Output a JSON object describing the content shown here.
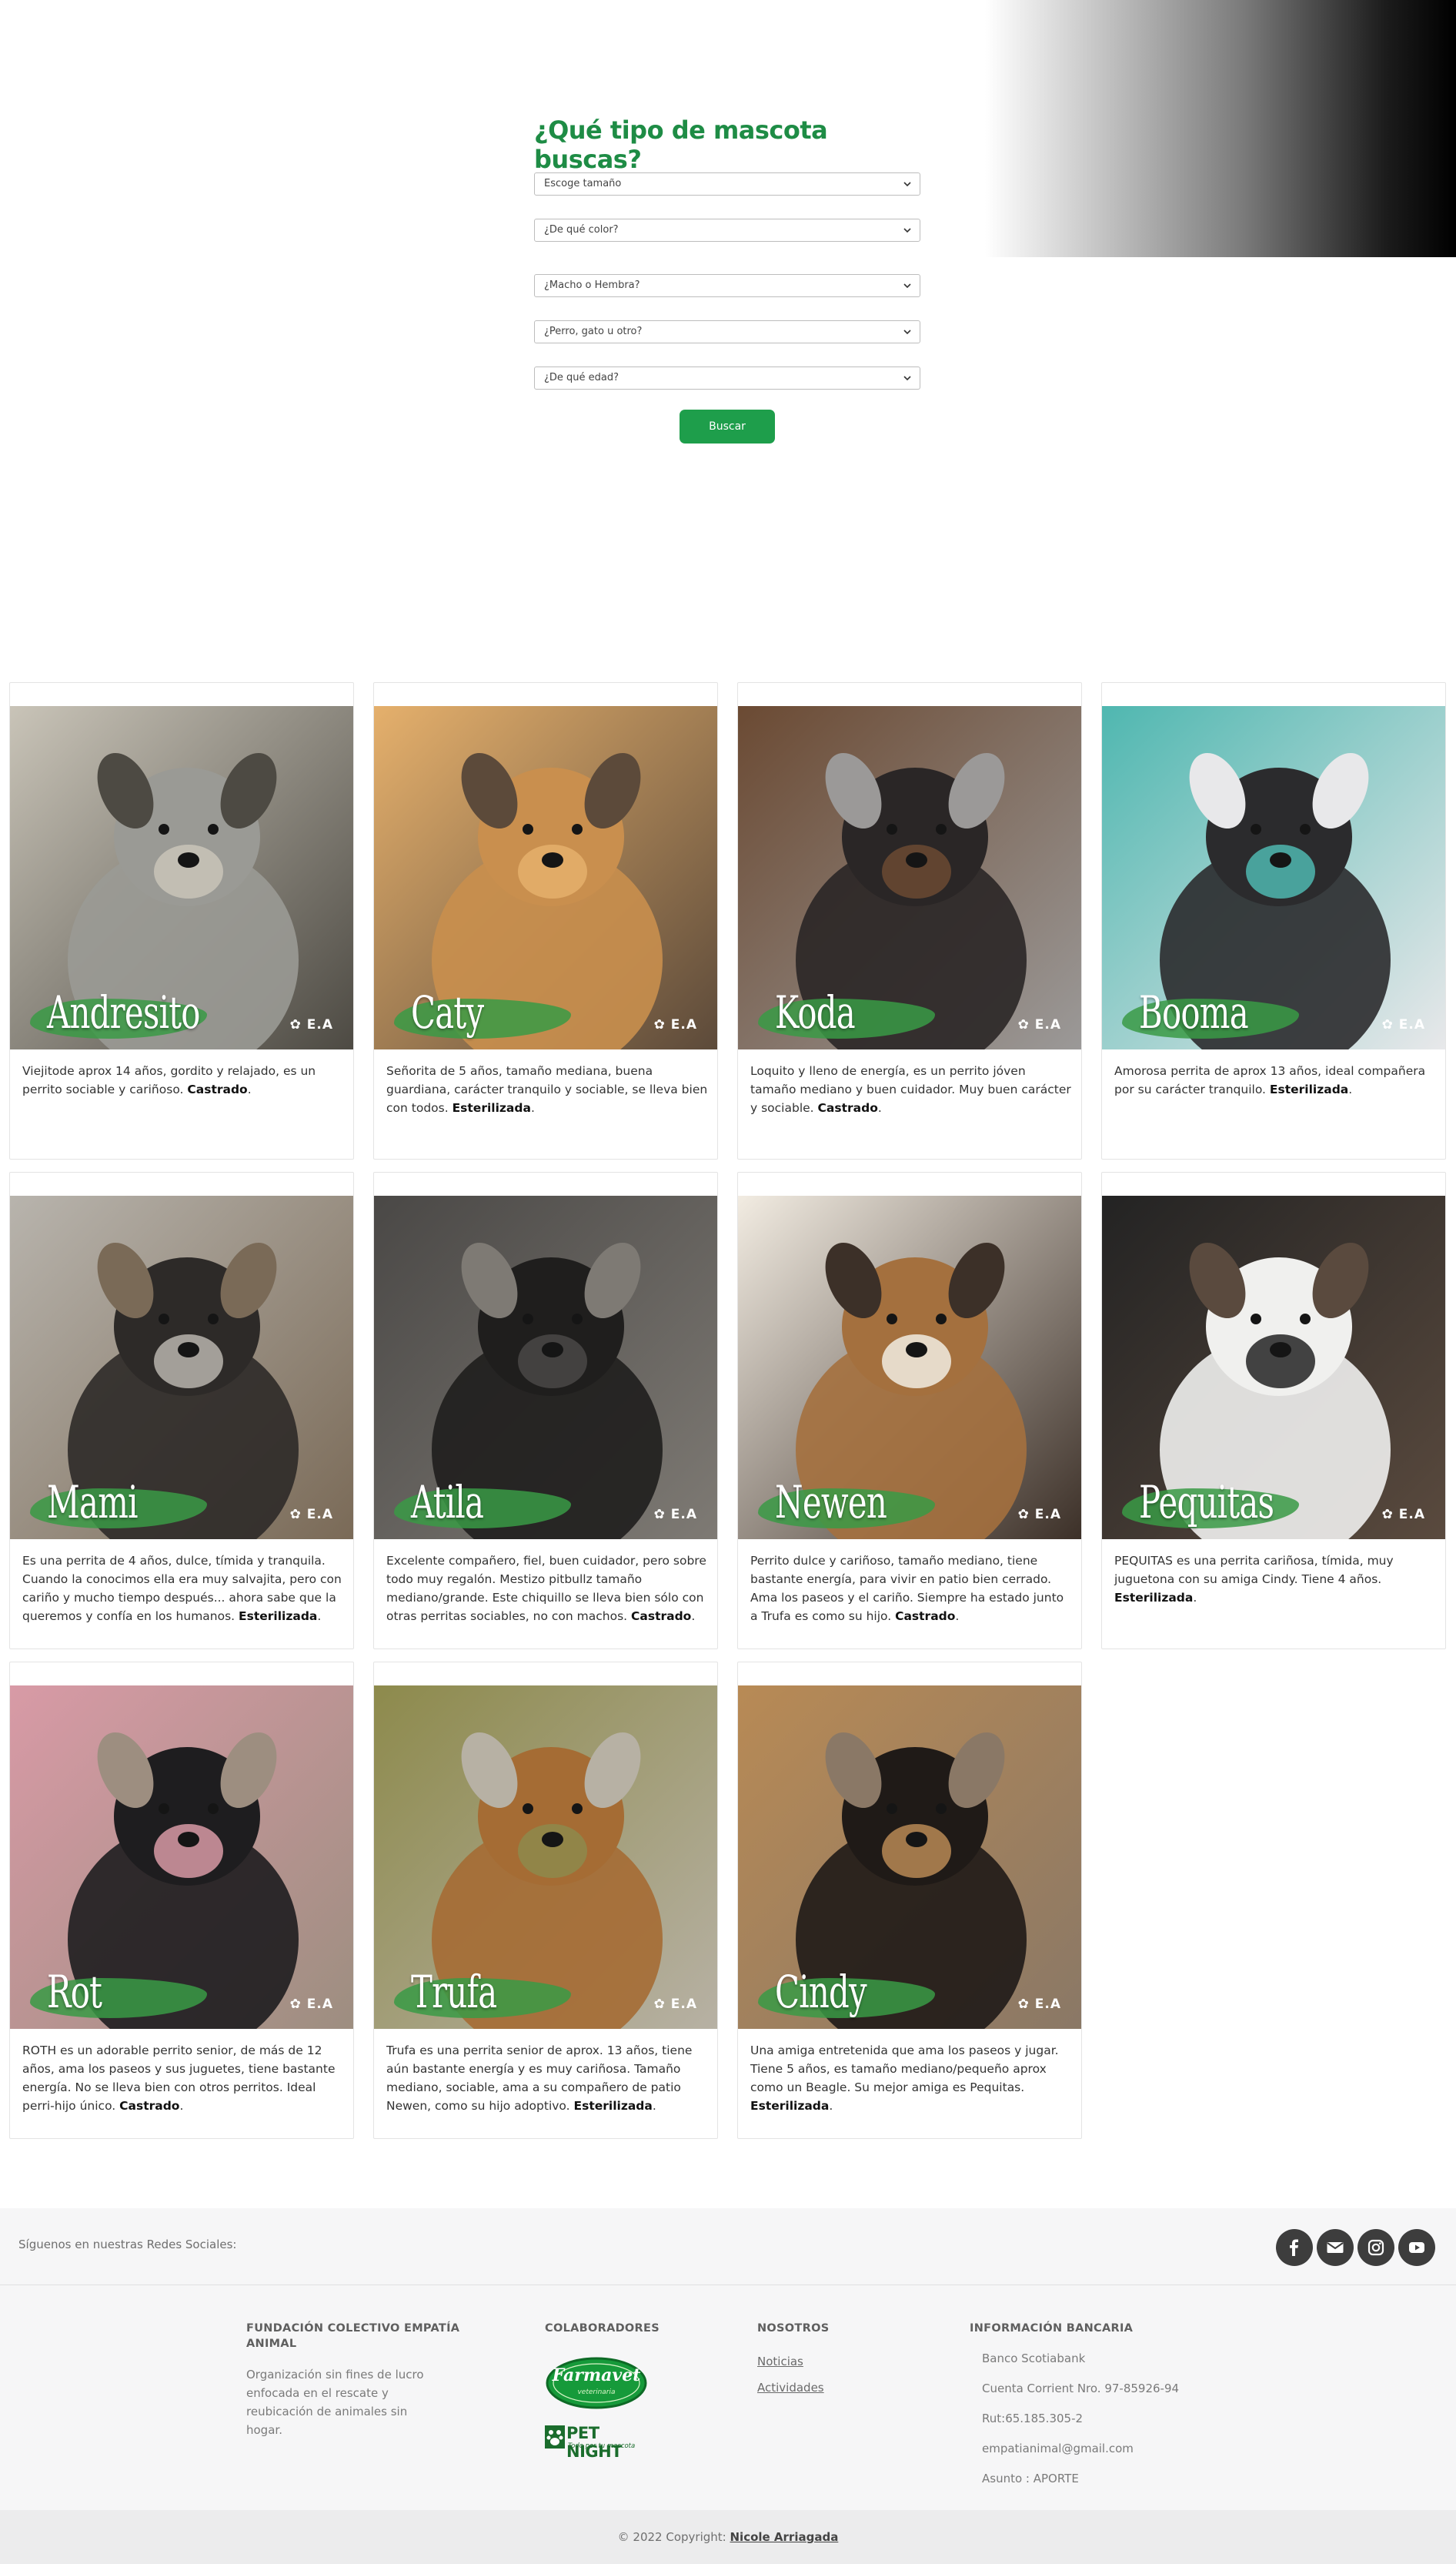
{
  "search": {
    "title": "¿Qué tipo de mascota buscas?",
    "filters": [
      {
        "value": "Escoge tamaño"
      },
      {
        "value": "¿De qué color?"
      },
      {
        "value": "¿Macho o Hembra?"
      },
      {
        "value": "¿Perro, gato u otro?"
      },
      {
        "value": "¿De qué edad?"
      }
    ],
    "button_label": "Buscar"
  },
  "pets": [
    {
      "name": "Andresito",
      "desc": "Viejitode aprox 14 años, gordito y relajado, es un perrito sociable y cariñoso.",
      "status": "Castrado",
      "colors": [
        "#4d4a43",
        "#9a9a95",
        "#c9c4b8"
      ]
    },
    {
      "name": "Caty",
      "desc": "Señorita de 5 años, tamaño mediana, buena guardiana, carácter tranquilo y sociable, se lleva bien con todos.",
      "status": "Esterilizada",
      "colors": [
        "#5c4a3a",
        "#c98f4e",
        "#e5b06c"
      ]
    },
    {
      "name": "Koda",
      "desc": "Loquito y lleno de energía, es un perrito jóven tamaño mediano y buen cuidador. Muy buen carácter y sociable.",
      "status": "Castrado",
      "colors": [
        "#9b9998",
        "#2a2626",
        "#6b4a33"
      ]
    },
    {
      "name": "Booma",
      "desc": "Amorosa perrita de aprox 13 años, ideal compañera por su carácter tranquilo.",
      "status": "Esterilizada",
      "colors": [
        "#e8e8ea",
        "#2b2b2d",
        "#4fb7b0"
      ]
    },
    {
      "name": "Mami",
      "desc": "Es una perrita de 4 años, dulce, tímida y tranquila. Cuando la conocimos ella era muy salvajita, pero con cariño y mucho tiempo después... ahora sabe que la queremos y confía en los humanos.",
      "status": "Esterilizada",
      "colors": [
        "#7a6a57",
        "#2d2a28",
        "#b8b4ad"
      ]
    },
    {
      "name": "Atila",
      "desc": "Excelente compañero, fiel, buen cuidador, pero sobre todo muy regalón. Mestizo pitbullz tamaño mediano/grande. Este chiquillo se lleva bien sólo con otras perritas sociables, no con machos.",
      "status": "Castrado",
      "colors": [
        "#7e7a74",
        "#1f1e1d",
        "#4a4846"
      ]
    },
    {
      "name": "Newen",
      "desc": "Perrito dulce y cariñoso, tamaño mediano, tiene bastante energía, para vivir en patio bien cerrado. Ama los paseos y el cariño. Siempre ha estado junto a Trufa es como su hijo.",
      "status": "Castrado",
      "colors": [
        "#3c3028",
        "#a4703e",
        "#f2ece2"
      ]
    },
    {
      "name": "Pequitas",
      "desc": "PEQUITAS es una perrita cariñosa, tímida, muy juguetona con su amiga Cindy. Tiene 4 años.",
      "status": "Esterilizada",
      "colors": [
        "#5a4a3e",
        "#f0f0ee",
        "#232323"
      ]
    },
    {
      "name": "Rot",
      "desc": "ROTH es un adorable perrito senior, de más de 12 años, ama los paseos y sus juguetes, tiene bastante energía. No se lleva bien con otros perritos. Ideal perri-hijo único.",
      "status": "Castrado",
      "colors": [
        "#9d8e80",
        "#1e1d1f",
        "#d89aa6"
      ]
    },
    {
      "name": "Trufa",
      "desc": "Trufa es una perrita senior de aprox. 13 años, tiene aún bastante energía y es muy cariñosa. Tamaño mediano, sociable, ama a su compañero de patio Newen, como su hijo adoptivo.",
      "status": "Esterilizada",
      "colors": [
        "#b7b1a4",
        "#a56c34",
        "#8d8a4c"
      ]
    },
    {
      "name": "Cindy",
      "desc": "Una amiga entretenida que ama los paseos y jugar. Tiene 5 años, es tamaño mediano/pequeño aprox como un Beagle. Su mejor amiga es Pequitas.",
      "status": "Esterilizada",
      "colors": [
        "#8a7866",
        "#1f1a17",
        "#b88a55"
      ]
    }
  ],
  "photo_logo": "E.A",
  "social": {
    "label": "Síguenos en nuestras Redes Sociales:",
    "icons": [
      "facebook-icon",
      "email-icon",
      "instagram-icon",
      "youtube-icon"
    ]
  },
  "footer": {
    "org_title": "FUNDACIÓN COLECTIVO EMPATÍA ANIMAL",
    "org_desc": "Organización sin fines de lucro enfocada en el rescate y reubicación de animales sin hogar.",
    "collab_title": "COLABORADORES",
    "collab_1": "Farmavet",
    "collab_1_sub": "veterinaria",
    "collab_2": "PET NIGHT",
    "collab_2_sub": "Todo por tu mascota",
    "about_title": "NOSOTROS",
    "about_links": [
      "Noticias",
      "Actividades"
    ],
    "bank_title": "INFORMACIÓN BANCARIA",
    "bank_lines": [
      "Banco Scotiabank",
      "Cuenta Corrient Nro. 97-85926-94",
      "Rut:65.185.305-2",
      "empatianimal@gmail.com",
      "Asunto : APORTE"
    ]
  },
  "copyright": {
    "text": "© 2022 Copyright:",
    "author": "Nicole Arriagada"
  },
  "colors": {
    "brand_green": "#1e8c45",
    "button_green": "#1e9e4b",
    "social_icon_bg": "#3d3d3d"
  }
}
